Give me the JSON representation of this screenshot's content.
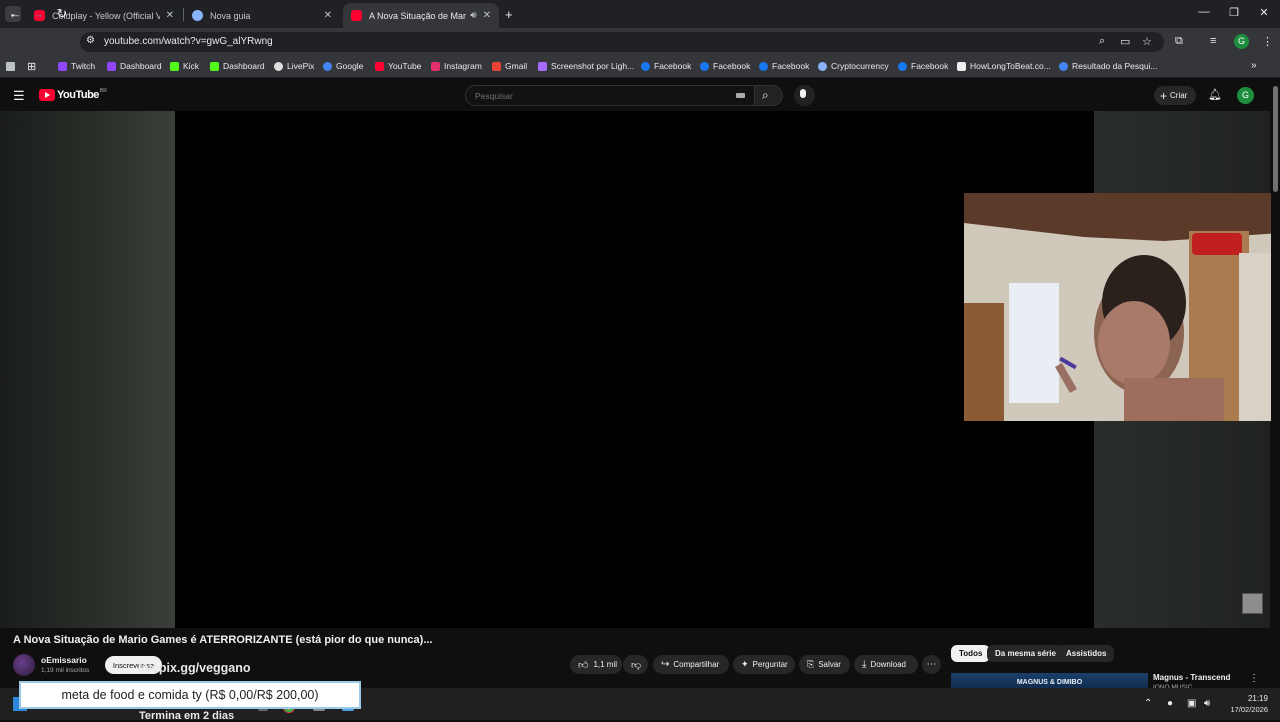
{
  "browser": {
    "tabs": [
      {
        "title": "Coldplay - Yellow (Official Vide",
        "favicon_color": "#ff0033",
        "active": false
      },
      {
        "title": "Nova guia",
        "favicon_color": "#8ab4f8",
        "active": false
      },
      {
        "title": "A Nova Situação de Mario G",
        "favicon_color": "#ff0033",
        "active": true,
        "audio": true
      }
    ],
    "url": "youtube.com/watch?v=gwG_alYRwng",
    "profile_initial": "G",
    "bookmarks": [
      {
        "label": "Twitch",
        "color": "#9146ff"
      },
      {
        "label": "Dashboard",
        "color": "#9146ff"
      },
      {
        "label": "Kick",
        "color": "#53fc18"
      },
      {
        "label": "Dashboard",
        "color": "#53fc18"
      },
      {
        "label": "LivePix",
        "color": "#dddddd"
      },
      {
        "label": "Google",
        "color": "#4285f4"
      },
      {
        "label": "YouTube",
        "color": "#ff0033"
      },
      {
        "label": "Instagram",
        "color": "#e1306c"
      },
      {
        "label": "Gmail",
        "color": "#ea4335"
      },
      {
        "label": "Screenshot por Ligh...",
        "color": "#a66cff"
      },
      {
        "label": "Facebook",
        "color": "#1877f2"
      },
      {
        "label": "Facebook",
        "color": "#1877f2"
      },
      {
        "label": "Facebook",
        "color": "#1877f2"
      },
      {
        "label": "Cryptocurrency",
        "color": "#8ab4f8"
      },
      {
        "label": "Facebook",
        "color": "#1877f2"
      },
      {
        "label": "HowLongToBeat.co...",
        "color": "#eeeeee"
      },
      {
        "label": "Resultado da Pesqui...",
        "color": "#4285f4"
      }
    ]
  },
  "youtube": {
    "logo_text": "YouTube",
    "logo_suffix": "BR",
    "search_placeholder": "Pesquisar",
    "create_label": "Criar",
    "avatar_initial": "G"
  },
  "video": {
    "title": "A Nova Situação de Mario Games é ATERRORIZANTE (está pior do que nunca)...",
    "channel": "oEmissario",
    "subscribers": "1,19 mil inscritos",
    "subscribe_label": "Inscrever-se",
    "overlay_link": "livepix.gg/veggano",
    "likes": "1,1 mil",
    "share_label": "Compartilhar",
    "ask_label": "Perguntar",
    "save_label": "Salvar",
    "download_label": "Download"
  },
  "sidebar": {
    "chips": [
      "Todos",
      "Da mesma série",
      "Assistidos"
    ],
    "next_video_title": "Magnus - Transcend",
    "next_video_thumb_text": "MAGNUS & DIMIBO",
    "next_video_channel": "IONO MUSIC"
  },
  "overlay": {
    "goal_text": "meta de food e comida ty (R$ 0,00/R$ 200,00)",
    "ends_text": "Termina em 2 dias"
  },
  "taskbar": {
    "time": "21:19",
    "date": "17/02/2026"
  },
  "colors": {
    "youtube_red": "#ff0033",
    "chrome_dark": "#202124",
    "chrome_toolbar": "#35363a"
  }
}
